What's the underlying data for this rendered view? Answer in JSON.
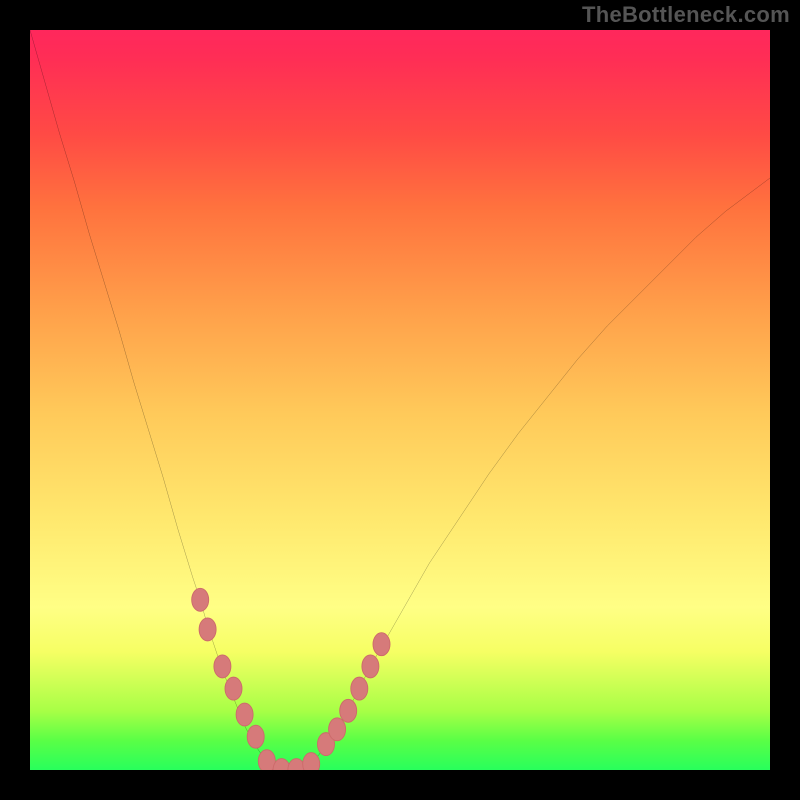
{
  "attribution": "TheBottleneck.com",
  "colors": {
    "curve_stroke": "#000000",
    "marker_fill": "#d67a7a",
    "marker_stroke": "#cc6a6a",
    "frame": "#000000"
  },
  "chart_data": {
    "type": "line",
    "title": "",
    "xlabel": "",
    "ylabel": "",
    "xlim": [
      0,
      100
    ],
    "ylim": [
      0,
      100
    ],
    "series": [
      {
        "name": "bottleneck-curve",
        "x": [
          0,
          2,
          4,
          6,
          8,
          10,
          12,
          14,
          16,
          18,
          20,
          22,
          23,
          24,
          25,
          26,
          27,
          28,
          29,
          30,
          31,
          32,
          33,
          34,
          35,
          36,
          37,
          38,
          39,
          40,
          42,
          44,
          46,
          48,
          50,
          54,
          58,
          62,
          66,
          70,
          74,
          78,
          82,
          86,
          90,
          94,
          98,
          100
        ],
        "y": [
          100,
          93,
          86,
          79.5,
          72.5,
          66,
          59.5,
          52.5,
          46,
          39.5,
          32.5,
          26,
          23,
          19.5,
          16.5,
          13.5,
          11,
          8.5,
          6,
          4,
          2.5,
          1.2,
          0.5,
          0.2,
          0,
          0,
          0.3,
          1,
          2,
          3.5,
          6.5,
          10,
          14,
          17.5,
          21,
          28,
          34,
          40,
          45.5,
          50.5,
          55.5,
          60,
          64,
          68,
          72,
          75.5,
          78.5,
          80
        ]
      }
    ],
    "markers": {
      "name": "highlighted-points",
      "x": [
        23,
        24,
        26,
        27.5,
        29,
        30.5,
        32,
        34,
        36,
        38,
        40,
        41.5,
        43,
        44.5,
        46,
        47.5
      ],
      "y": [
        23,
        19,
        14,
        11,
        7.5,
        4.5,
        1.2,
        0,
        0,
        0.8,
        3.5,
        5.5,
        8,
        11,
        14,
        17
      ]
    },
    "legend": false,
    "grid": false
  }
}
